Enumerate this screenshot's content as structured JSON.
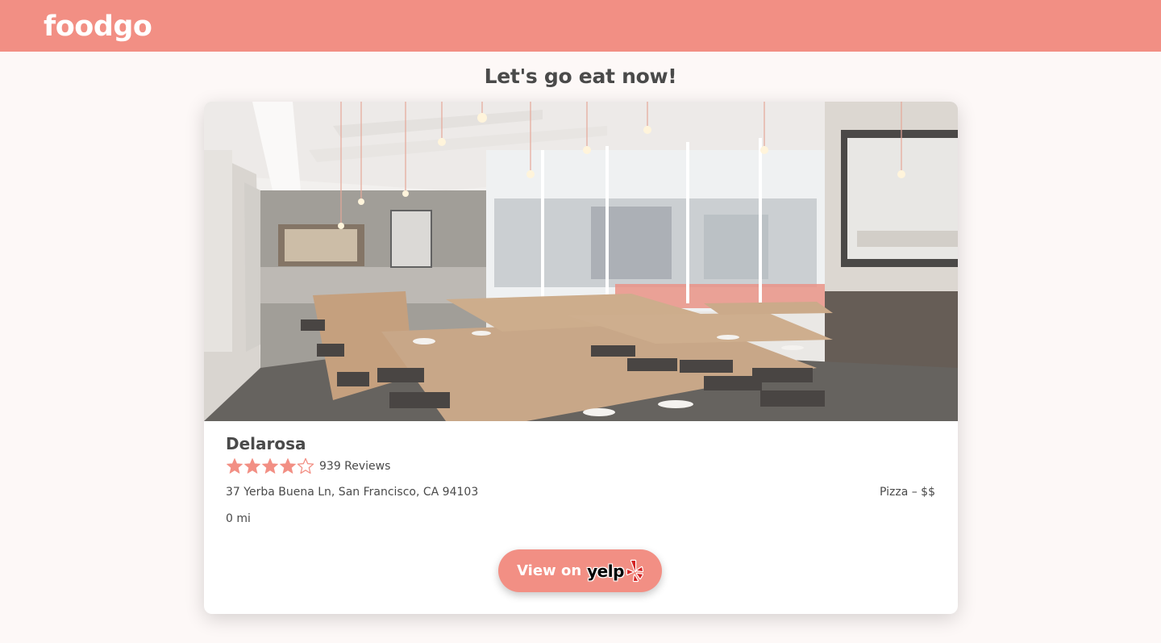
{
  "header": {
    "logo": "foodgo",
    "background_color": "#f28f84"
  },
  "page": {
    "title": "Let's go eat now!"
  },
  "restaurant": {
    "image_icon": "restaurant-interior-photo",
    "name": "Delarosa",
    "rating": 4,
    "rating_max": 5,
    "reviews": "939 Reviews",
    "address": "37 Yerba Buena Ln, San Francisco, CA 94103",
    "category": "Pizza – $$",
    "distance": "0 mi"
  },
  "actions": {
    "view_button_label": "View on",
    "yelp_wordmark": "yelp",
    "yelp_icon": "yelp-burst-icon"
  },
  "colors": {
    "accent": "#f28f84",
    "text": "#4a4a4a",
    "star_filled": "#f28f84",
    "page_background": "#fdf8f7"
  }
}
